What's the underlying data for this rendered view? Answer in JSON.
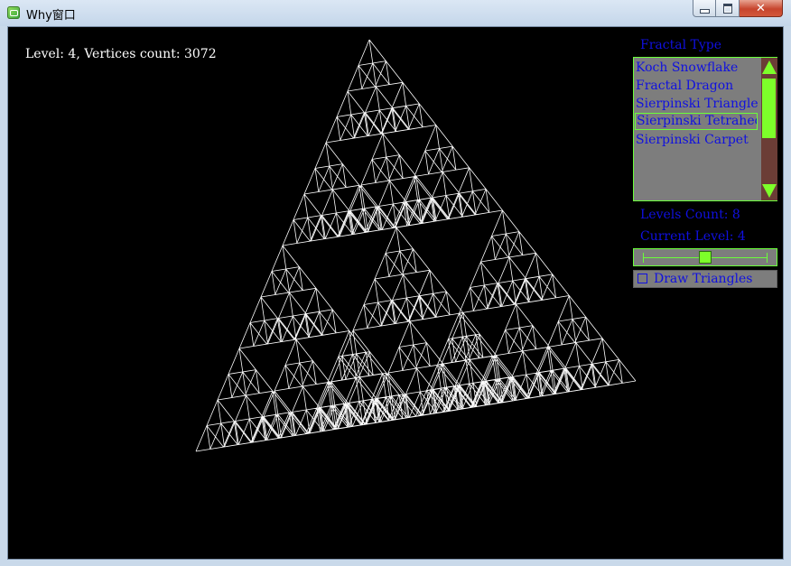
{
  "window": {
    "title": "Why窗口",
    "close_glyph": "✕"
  },
  "status": {
    "text": "Level: 4, Vertices count: 3072"
  },
  "fractal": {
    "level": 4,
    "stroke_color": "#ffffff"
  },
  "panel": {
    "fractal_type_label": "Fractal Type",
    "list_items": [
      "Koch Snowflake",
      "Fractal Dragon",
      "Sierpinski Triangle",
      "Sierpinski Tetrahedron",
      "Sierpinski Carpet"
    ],
    "selected_index": 3,
    "levels_count_label": "Levels Count: 8",
    "current_level_label": "Current Level: 4",
    "slider": {
      "min": 0,
      "max": 8,
      "value": 4
    },
    "draw_triangles_label": "Draw Triangles",
    "draw_triangles_checked": false
  },
  "colors": {
    "accent": "#6aff3a",
    "text": "#1010e0",
    "panel_bg": "#7d7d7d",
    "scroll_bg": "#6b3d36"
  }
}
